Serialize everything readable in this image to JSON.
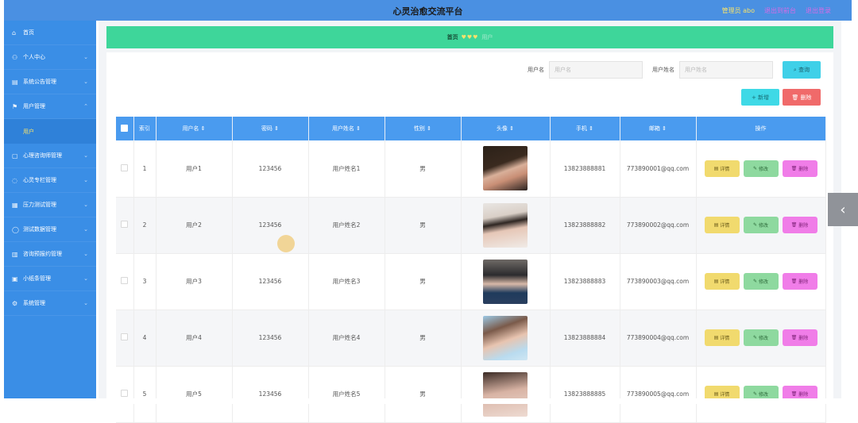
{
  "header": {
    "title": "心灵治愈交流平台",
    "admin_label": "管理员 abo",
    "link1": "退出到前台",
    "link2": "退出登录"
  },
  "sidebar": {
    "items": [
      {
        "icon": "home-icon",
        "label": "首页"
      },
      {
        "icon": "user-icon",
        "label": "个人中心"
      },
      {
        "icon": "notice-icon",
        "label": "系统公告管理"
      },
      {
        "icon": "flag-icon",
        "label": "用户管理"
      },
      {
        "icon": "consult-icon",
        "label": "心理咨询师管理"
      },
      {
        "icon": "column-icon",
        "label": "心灵专栏管理"
      },
      {
        "icon": "test-icon",
        "label": "压力测试管理"
      },
      {
        "icon": "data-icon",
        "label": "测试数据管理"
      },
      {
        "icon": "report-icon",
        "label": "咨询预报约管理"
      },
      {
        "icon": "note-icon",
        "label": "小纸条管理"
      },
      {
        "icon": "system-icon",
        "label": "系统管理"
      }
    ],
    "sub_item": "用户"
  },
  "breadcrumb": {
    "home": "首页",
    "current": "用户"
  },
  "search": {
    "username_label": "用户名",
    "username_placeholder": "用户名",
    "realname_label": "用户姓名",
    "realname_placeholder": "用户姓名",
    "query_label": "查询"
  },
  "actions": {
    "add_label": "新增",
    "delete_label": "删除"
  },
  "table": {
    "headers": [
      "索引",
      "用户名",
      "密码",
      "用户姓名",
      "性别",
      "头像",
      "手机",
      "邮箱",
      "操作"
    ],
    "rows": [
      {
        "index": "1",
        "username": "用户1",
        "password": "123456",
        "realname": "用户姓名1",
        "gender": "男",
        "phone": "13823888881",
        "email": "773890001@qq.com"
      },
      {
        "index": "2",
        "username": "用户2",
        "password": "123456",
        "realname": "用户姓名2",
        "gender": "男",
        "phone": "13823888882",
        "email": "773890002@qq.com"
      },
      {
        "index": "3",
        "username": "用户3",
        "password": "123456",
        "realname": "用户姓名3",
        "gender": "男",
        "phone": "13823888883",
        "email": "773890003@qq.com"
      },
      {
        "index": "4",
        "username": "用户4",
        "password": "123456",
        "realname": "用户姓名4",
        "gender": "男",
        "phone": "13823888884",
        "email": "773890004@qq.com"
      },
      {
        "index": "5",
        "username": "用户5",
        "password": "123456",
        "realname": "用户姓名5",
        "gender": "男",
        "phone": "13823888885",
        "email": "773890005@qq.com"
      }
    ],
    "op_detail": "详情",
    "op_edit": "修改",
    "op_delete": "删除"
  },
  "colors": {
    "accent": "#4a90e2",
    "crumb": "#3ed69a",
    "table_head": "#4a9bef"
  }
}
